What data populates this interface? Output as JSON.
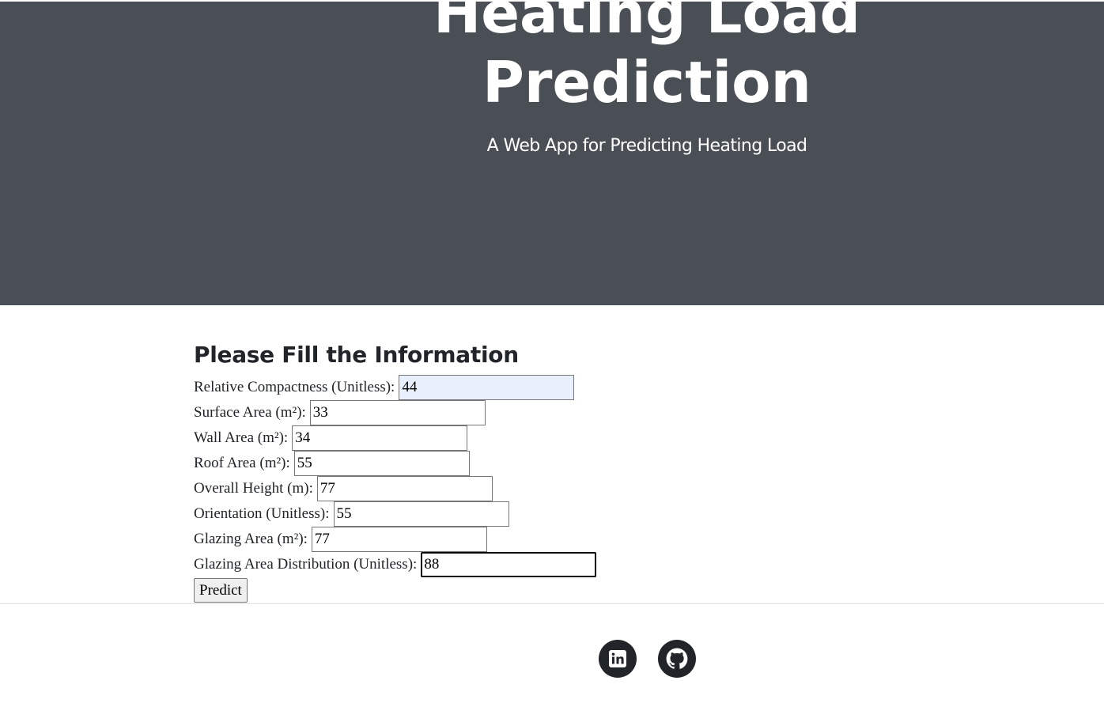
{
  "header": {
    "title": "Heating Load Prediction",
    "subtitle": "A Web App for Predicting Heating Load"
  },
  "form": {
    "heading": "Please Fill the Information",
    "fields": [
      {
        "label": "Relative Compactness (Unitless):",
        "value": "44"
      },
      {
        "label": "Surface Area (m²):",
        "value": "33"
      },
      {
        "label": "Wall Area (m²):",
        "value": "34"
      },
      {
        "label": "Roof Area (m²):",
        "value": "55"
      },
      {
        "label": "Overall Height (m):",
        "value": "77"
      },
      {
        "label": "Orientation (Unitless):",
        "value": "55"
      },
      {
        "label": "Glazing Area (m²):",
        "value": "77"
      },
      {
        "label": "Glazing Area Distribution (Unitless):",
        "value": "88"
      }
    ],
    "submit_label": "Predict"
  },
  "footer": {
    "social": [
      {
        "icon": "linkedin-icon"
      },
      {
        "icon": "github-icon"
      }
    ]
  },
  "colors": {
    "hero_background": "#4a4e55",
    "text": "#212529",
    "autofill_background": "#e8f0fe",
    "social_background": "#212529"
  }
}
